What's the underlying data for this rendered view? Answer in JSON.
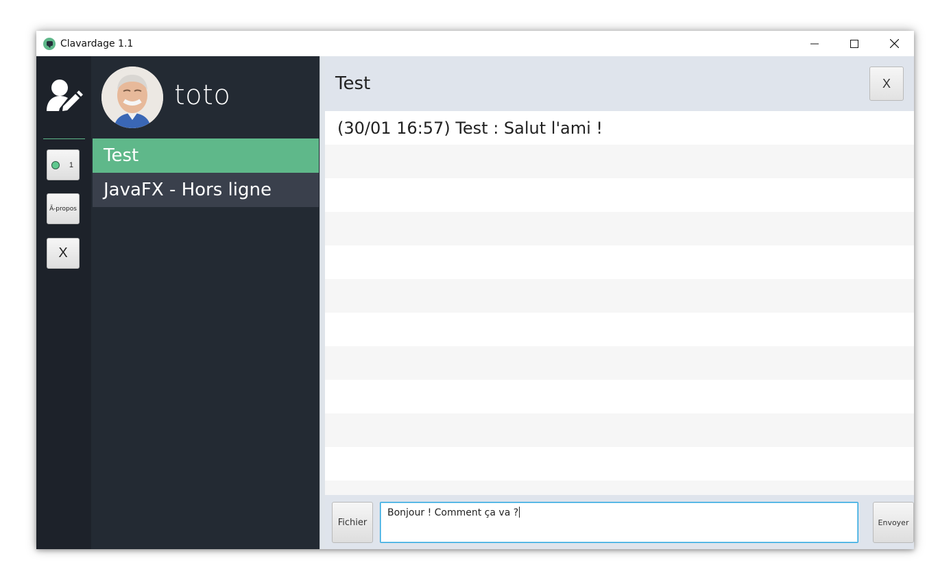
{
  "window": {
    "title": "Clavardage 1.1"
  },
  "rail": {
    "online_count": "1",
    "about_label": "Ã-propos",
    "close_label": "X",
    "accent_color": "#5fb88a"
  },
  "profile": {
    "username": "toto"
  },
  "contacts": [
    {
      "label": "Test",
      "state": "active"
    },
    {
      "label": "JavaFX - Hors ligne",
      "state": "offline"
    }
  ],
  "chat": {
    "title": "Test",
    "close_label": "X",
    "messages": [
      "(30/01 16:57) Test : Salut l'ami !"
    ]
  },
  "composer": {
    "file_label": "Fichier",
    "input_value": "Bonjour ! Comment ça va ?",
    "send_label": "Envoyer"
  }
}
